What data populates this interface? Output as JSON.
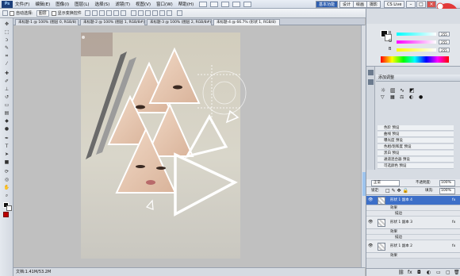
{
  "menubar": {
    "app_icon": "Ps",
    "items": [
      "文件(F)",
      "编辑(E)",
      "图像(I)",
      "图层(L)",
      "选择(S)",
      "滤镜(T)",
      "视图(V)",
      "窗口(W)",
      "帮助(H)"
    ],
    "workspace_buttons": [
      "基本功能",
      "设计",
      "绘画",
      "摄影"
    ],
    "cs_live": "CS Live",
    "window_controls": [
      "–",
      "□",
      "×"
    ]
  },
  "options_bar": {
    "auto_select_label": "自动选择:",
    "auto_select_value": "图层",
    "show_transform_label": "显示变换控件"
  },
  "tabs": [
    {
      "label": "未标题-1 @ 100% (图层 0, RGB/8)"
    },
    {
      "label": "未标题-2 @ 100% (图层 1, RGB/8#)"
    },
    {
      "label": "未标题-3 @ 100% (图层 2, RGB/8#)"
    },
    {
      "label": "未标题-4 @ 66.7% (形状 1, RGB/8)"
    }
  ],
  "status_bar": {
    "text": "文档:1.41M/53.2M"
  },
  "color_panel": {
    "channels": [
      {
        "label": "R",
        "value": "255",
        "color": "#e03030"
      },
      {
        "label": "G",
        "value": "255",
        "color": "#30b030"
      },
      {
        "label": "B",
        "value": "255",
        "color": "#3050e0"
      }
    ]
  },
  "adjustments_panel": {
    "title": "添加调整",
    "presets": [
      "色阶 预设",
      "曲线 预设",
      "曝光度 预设",
      "色相/饱和度 预设",
      "黑白 预设",
      "通道混合器 预设",
      "可选颜色 预设"
    ]
  },
  "layers_panel": {
    "blend_mode": "正常",
    "opacity_label": "不透明度:",
    "opacity_value": "100%",
    "lock_label": "锁定:",
    "fill_label": "填充:",
    "fill_value": "100%",
    "layers": [
      {
        "name": "形状 1 副本 4",
        "selected": true,
        "effects": [
          "效果",
          "描边"
        ]
      },
      {
        "name": "形状 1 副本 3",
        "selected": false,
        "effects": [
          "效果",
          "描边"
        ]
      },
      {
        "name": "形状 1 副本 2",
        "selected": false,
        "effects": [
          "效果"
        ]
      }
    ]
  },
  "colors": {
    "accent": "#3d6fc8",
    "canvas_bg": "#d8d4c8"
  }
}
